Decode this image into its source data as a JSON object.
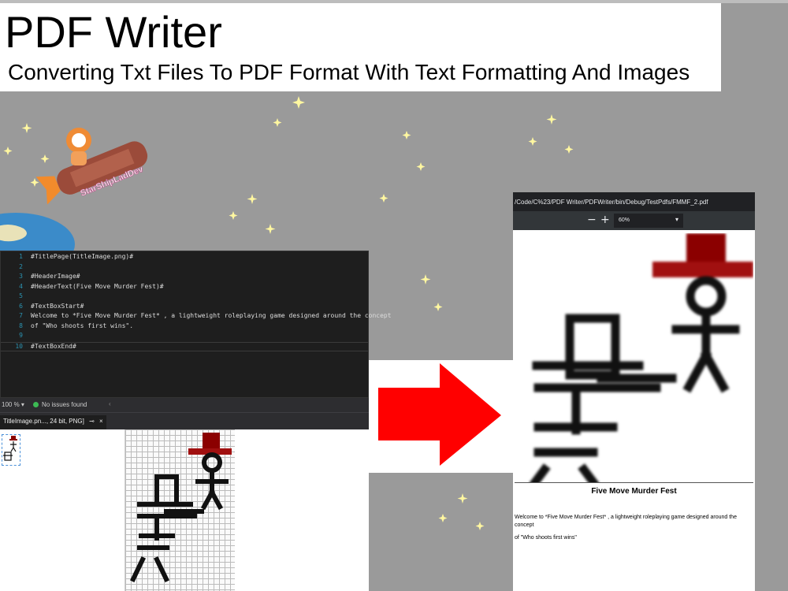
{
  "slide": {
    "title": "PDF Writer",
    "subtitle": "Converting Txt Files To PDF Format With Text Formatting And Images"
  },
  "mascot": {
    "logo_text": "StarShipLadDev"
  },
  "editor": {
    "lines": [
      {
        "num": "1",
        "text": "#TitlePage(TitleImage.png)#"
      },
      {
        "num": "2",
        "text": ""
      },
      {
        "num": "3",
        "text": "#HeaderImage#"
      },
      {
        "num": "4",
        "text": "#HeaderText(Five Move Murder Fest)#"
      },
      {
        "num": "5",
        "text": ""
      },
      {
        "num": "6",
        "text": "#TextBoxStart#"
      },
      {
        "num": "7",
        "text": "Welcome to *Five Move Murder Fest* , a lightweight roleplaying game designed around the concept"
      },
      {
        "num": "8",
        "text": "of \"Who shoots first wins\"."
      },
      {
        "num": "9",
        "text": ""
      },
      {
        "num": "10",
        "text": "#TextBoxEnd#"
      }
    ],
    "status": {
      "zoom": "100 %",
      "zoom_caret": "▾",
      "issues": "No issues found"
    },
    "tab": {
      "label": "TitleImage.pn..., 24 bit, PNG]",
      "pin": "⊸",
      "close": "×"
    }
  },
  "pdf_viewer": {
    "url": "/Code/C%23/PDF Writer/PDFWriter/bin/Debug/TestPdfs/FMMF_2.pdf",
    "zoom": "60%",
    "zoom_caret": "▾",
    "minus": "−",
    "plus": "+",
    "page": {
      "header": "Five Move Murder Fest",
      "body_line1": "Welcome to *Five Move Murder Fest* , a lightweight roleplaying game designed around the concept",
      "body_line2": "of \"Who shoots first wins\""
    }
  },
  "colors": {
    "background": "#9a9a9a",
    "arrow": "#ff0000",
    "hat": "#8b0000",
    "editor_bg": "#1e1e1e"
  },
  "icons": [
    "right-arrow-icon",
    "no-issues-icon",
    "close-icon",
    "pin-icon",
    "zoom-out-icon",
    "zoom-in-icon",
    "chevron-down-icon",
    "star-icon"
  ]
}
